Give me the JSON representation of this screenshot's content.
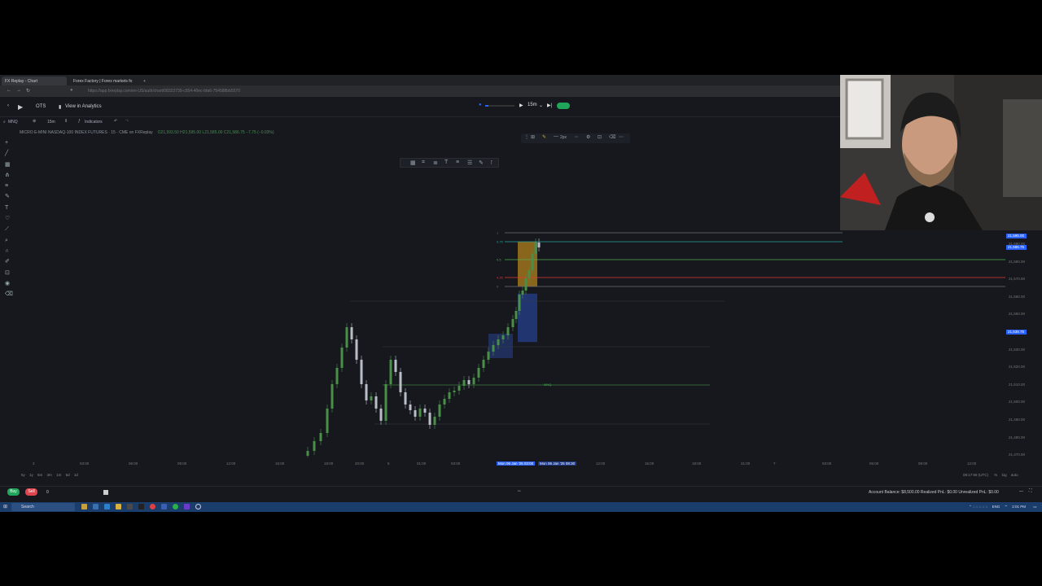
{
  "browser": {
    "tabs": [
      {
        "label": "FX Replay - Chart"
      },
      {
        "label": "Forex Factory | Forex markets fo"
      }
    ],
    "new_tab": "+",
    "url": "https://app.fxreplay.com/en-US/auth/chart/08323739-c554-40ec-bfa6-754588bb5570"
  },
  "header": {
    "back": "‹",
    "title": "OTS",
    "analytics_label": "View in Analytics",
    "replay": {
      "speed": "15m",
      "progress": 0.1,
      "enabled": true
    }
  },
  "toolbar": {
    "symbol": "MNQ",
    "interval": "15m",
    "indicators_label": "Indicators"
  },
  "legend": {
    "title": "MICRO E-MINI NASDAQ-100 INDEX FUTURES · 15 · CME on FXReplay",
    "ohlc": "O21,593.50 H21,595.00 L21,585.00 C21,586.75 −7.75 (−0.03%)"
  },
  "fib_levels": [
    {
      "label": "1",
      "color": "#6b6f76"
    },
    {
      "label": "0.75",
      "color": "#26a69a"
    },
    {
      "label": "0.5",
      "color": "#4caf50"
    },
    {
      "label": "0.25",
      "color": "#e53935"
    },
    {
      "label": "0",
      "color": "#6b6f76"
    }
  ],
  "price_axis": {
    "badges": [
      {
        "label": "21,595.00"
      },
      {
        "label": "21,586.75",
        "symbol": "MNQ"
      },
      {
        "label": "21,538.75"
      }
    ],
    "ticks": [
      "21,590.00",
      "21,580.00",
      "21,570.00",
      "21,560.00",
      "21,550.00",
      "21,540.00",
      "21,530.00",
      "21,520.00",
      "21,510.00",
      "21,500.00",
      "21,490.00",
      "21,480.00",
      "21,470.00"
    ]
  },
  "time_axis": {
    "ticks": [
      "3",
      "03:00",
      "06:00",
      "09:00",
      "12:00",
      "15:00",
      "18:00",
      "20:00",
      "5",
      "01:00",
      "03:00",
      "12:00",
      "15:00",
      "18:00",
      "21:00",
      "7",
      "03:00",
      "06:00",
      "09:00",
      "12:00"
    ],
    "highlighted_start": "Mon 06 Jan '25  03:00",
    "highlighted_end": "Mon 06 Jan '25  08:30"
  },
  "mid_label": "MNQ",
  "range_buttons": [
    "5y",
    "1y",
    "6m",
    "3m",
    "1m",
    "5d",
    "1d"
  ],
  "clock": "08:17:59 (UTC)",
  "scale_opts": [
    "%",
    "log",
    "auto"
  ],
  "trading": {
    "buy_label": "Buy",
    "sell_label": "Sell",
    "quantity": "0",
    "account": "Account Balance: $8,500.00    Realized PnL: $0.00    Unrealized PnL: $0.00"
  },
  "taskbar": {
    "search_placeholder": "Search",
    "time": "2:01 PM",
    "lang": "ENG"
  },
  "chart_data": {
    "type": "candlestick",
    "colors": {
      "up": "#4a8f48",
      "down": "#b9bec6"
    },
    "fib_prices": [
      21600.0,
      21595.0,
      21585.0,
      21575.0,
      21570.0
    ],
    "zones": [
      {
        "name": "long-target",
        "from": 21570.0,
        "to": 21595.0,
        "color": "#d99b1c"
      },
      {
        "name": "long-stop",
        "from": 21539.0,
        "to": 21566.0,
        "color": "#2a4aa8"
      }
    ]
  }
}
